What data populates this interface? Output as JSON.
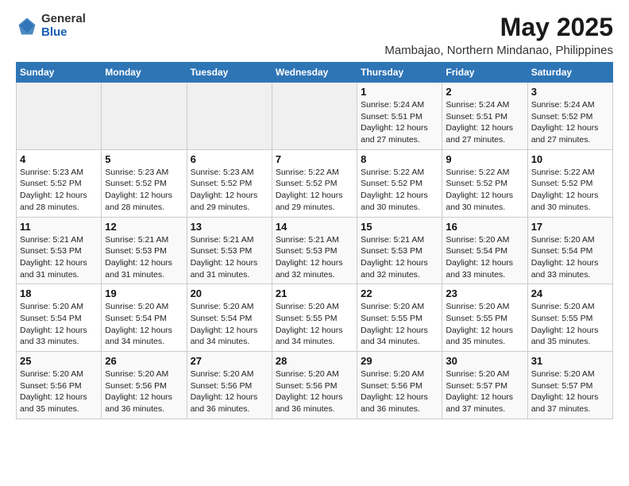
{
  "logo": {
    "general": "General",
    "blue": "Blue"
  },
  "title": "May 2025",
  "subtitle": "Mambajao, Northern Mindanao, Philippines",
  "days_header": [
    "Sunday",
    "Monday",
    "Tuesday",
    "Wednesday",
    "Thursday",
    "Friday",
    "Saturday"
  ],
  "weeks": [
    [
      {
        "day": "",
        "info": ""
      },
      {
        "day": "",
        "info": ""
      },
      {
        "day": "",
        "info": ""
      },
      {
        "day": "",
        "info": ""
      },
      {
        "day": "1",
        "info": "Sunrise: 5:24 AM\nSunset: 5:51 PM\nDaylight: 12 hours\nand 27 minutes."
      },
      {
        "day": "2",
        "info": "Sunrise: 5:24 AM\nSunset: 5:51 PM\nDaylight: 12 hours\nand 27 minutes."
      },
      {
        "day": "3",
        "info": "Sunrise: 5:24 AM\nSunset: 5:52 PM\nDaylight: 12 hours\nand 27 minutes."
      }
    ],
    [
      {
        "day": "4",
        "info": "Sunrise: 5:23 AM\nSunset: 5:52 PM\nDaylight: 12 hours\nand 28 minutes."
      },
      {
        "day": "5",
        "info": "Sunrise: 5:23 AM\nSunset: 5:52 PM\nDaylight: 12 hours\nand 28 minutes."
      },
      {
        "day": "6",
        "info": "Sunrise: 5:23 AM\nSunset: 5:52 PM\nDaylight: 12 hours\nand 29 minutes."
      },
      {
        "day": "7",
        "info": "Sunrise: 5:22 AM\nSunset: 5:52 PM\nDaylight: 12 hours\nand 29 minutes."
      },
      {
        "day": "8",
        "info": "Sunrise: 5:22 AM\nSunset: 5:52 PM\nDaylight: 12 hours\nand 30 minutes."
      },
      {
        "day": "9",
        "info": "Sunrise: 5:22 AM\nSunset: 5:52 PM\nDaylight: 12 hours\nand 30 minutes."
      },
      {
        "day": "10",
        "info": "Sunrise: 5:22 AM\nSunset: 5:52 PM\nDaylight: 12 hours\nand 30 minutes."
      }
    ],
    [
      {
        "day": "11",
        "info": "Sunrise: 5:21 AM\nSunset: 5:53 PM\nDaylight: 12 hours\nand 31 minutes."
      },
      {
        "day": "12",
        "info": "Sunrise: 5:21 AM\nSunset: 5:53 PM\nDaylight: 12 hours\nand 31 minutes."
      },
      {
        "day": "13",
        "info": "Sunrise: 5:21 AM\nSunset: 5:53 PM\nDaylight: 12 hours\nand 31 minutes."
      },
      {
        "day": "14",
        "info": "Sunrise: 5:21 AM\nSunset: 5:53 PM\nDaylight: 12 hours\nand 32 minutes."
      },
      {
        "day": "15",
        "info": "Sunrise: 5:21 AM\nSunset: 5:53 PM\nDaylight: 12 hours\nand 32 minutes."
      },
      {
        "day": "16",
        "info": "Sunrise: 5:20 AM\nSunset: 5:54 PM\nDaylight: 12 hours\nand 33 minutes."
      },
      {
        "day": "17",
        "info": "Sunrise: 5:20 AM\nSunset: 5:54 PM\nDaylight: 12 hours\nand 33 minutes."
      }
    ],
    [
      {
        "day": "18",
        "info": "Sunrise: 5:20 AM\nSunset: 5:54 PM\nDaylight: 12 hours\nand 33 minutes."
      },
      {
        "day": "19",
        "info": "Sunrise: 5:20 AM\nSunset: 5:54 PM\nDaylight: 12 hours\nand 34 minutes."
      },
      {
        "day": "20",
        "info": "Sunrise: 5:20 AM\nSunset: 5:54 PM\nDaylight: 12 hours\nand 34 minutes."
      },
      {
        "day": "21",
        "info": "Sunrise: 5:20 AM\nSunset: 5:55 PM\nDaylight: 12 hours\nand 34 minutes."
      },
      {
        "day": "22",
        "info": "Sunrise: 5:20 AM\nSunset: 5:55 PM\nDaylight: 12 hours\nand 34 minutes."
      },
      {
        "day": "23",
        "info": "Sunrise: 5:20 AM\nSunset: 5:55 PM\nDaylight: 12 hours\nand 35 minutes."
      },
      {
        "day": "24",
        "info": "Sunrise: 5:20 AM\nSunset: 5:55 PM\nDaylight: 12 hours\nand 35 minutes."
      }
    ],
    [
      {
        "day": "25",
        "info": "Sunrise: 5:20 AM\nSunset: 5:56 PM\nDaylight: 12 hours\nand 35 minutes."
      },
      {
        "day": "26",
        "info": "Sunrise: 5:20 AM\nSunset: 5:56 PM\nDaylight: 12 hours\nand 36 minutes."
      },
      {
        "day": "27",
        "info": "Sunrise: 5:20 AM\nSunset: 5:56 PM\nDaylight: 12 hours\nand 36 minutes."
      },
      {
        "day": "28",
        "info": "Sunrise: 5:20 AM\nSunset: 5:56 PM\nDaylight: 12 hours\nand 36 minutes."
      },
      {
        "day": "29",
        "info": "Sunrise: 5:20 AM\nSunset: 5:56 PM\nDaylight: 12 hours\nand 36 minutes."
      },
      {
        "day": "30",
        "info": "Sunrise: 5:20 AM\nSunset: 5:57 PM\nDaylight: 12 hours\nand 37 minutes."
      },
      {
        "day": "31",
        "info": "Sunrise: 5:20 AM\nSunset: 5:57 PM\nDaylight: 12 hours\nand 37 minutes."
      }
    ]
  ]
}
